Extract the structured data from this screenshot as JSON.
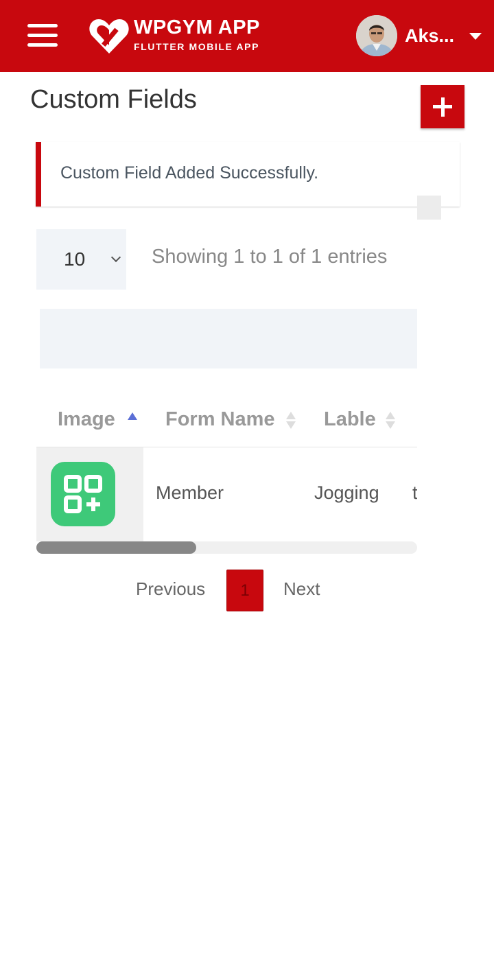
{
  "header": {
    "brand_title": "WPGYM APP",
    "brand_subtitle": "FLUTTER MOBILE APP",
    "user_name": "Aks...",
    "bg_color": "#c8080e"
  },
  "page": {
    "title": "Custom Fields"
  },
  "alert": {
    "message": "Custom Field Added Successfully."
  },
  "table_controls": {
    "page_length": "10",
    "entries_info": "Showing 1 to 1 of 1 entries"
  },
  "table": {
    "columns": [
      "Image",
      "Form Name",
      "Lable"
    ],
    "rows": [
      {
        "image_icon": "qr-app-icon",
        "form_name": "Member",
        "lable": "Jogging",
        "next_col_partial": "t"
      }
    ]
  },
  "pagination": {
    "previous": "Previous",
    "current": "1",
    "next": "Next"
  },
  "icons": [
    "menu-icon",
    "brand-logo-icon",
    "user-avatar",
    "dropdown-caret-icon",
    "plus-icon",
    "chevron-down-icon",
    "sort-asc-icon",
    "sort-icon",
    "qr-app-icon"
  ]
}
